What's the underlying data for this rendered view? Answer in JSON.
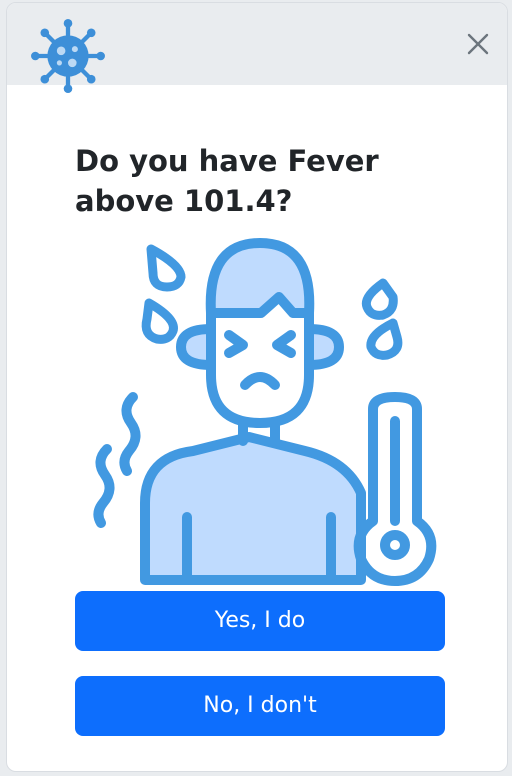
{
  "dialog": {
    "question": "Do you have Fever above 101.4?",
    "yes_label": "Yes, I do",
    "no_label": "No, I don't"
  },
  "icons": {
    "logo": "virus-icon",
    "close": "close-icon",
    "illustration": "fever-person-thermometer-icon"
  },
  "colors": {
    "accent_blue": "#4299e1",
    "light_blue": "#bfdbfe",
    "button_blue": "#0d6efd",
    "header_gray": "#e9ecef"
  }
}
